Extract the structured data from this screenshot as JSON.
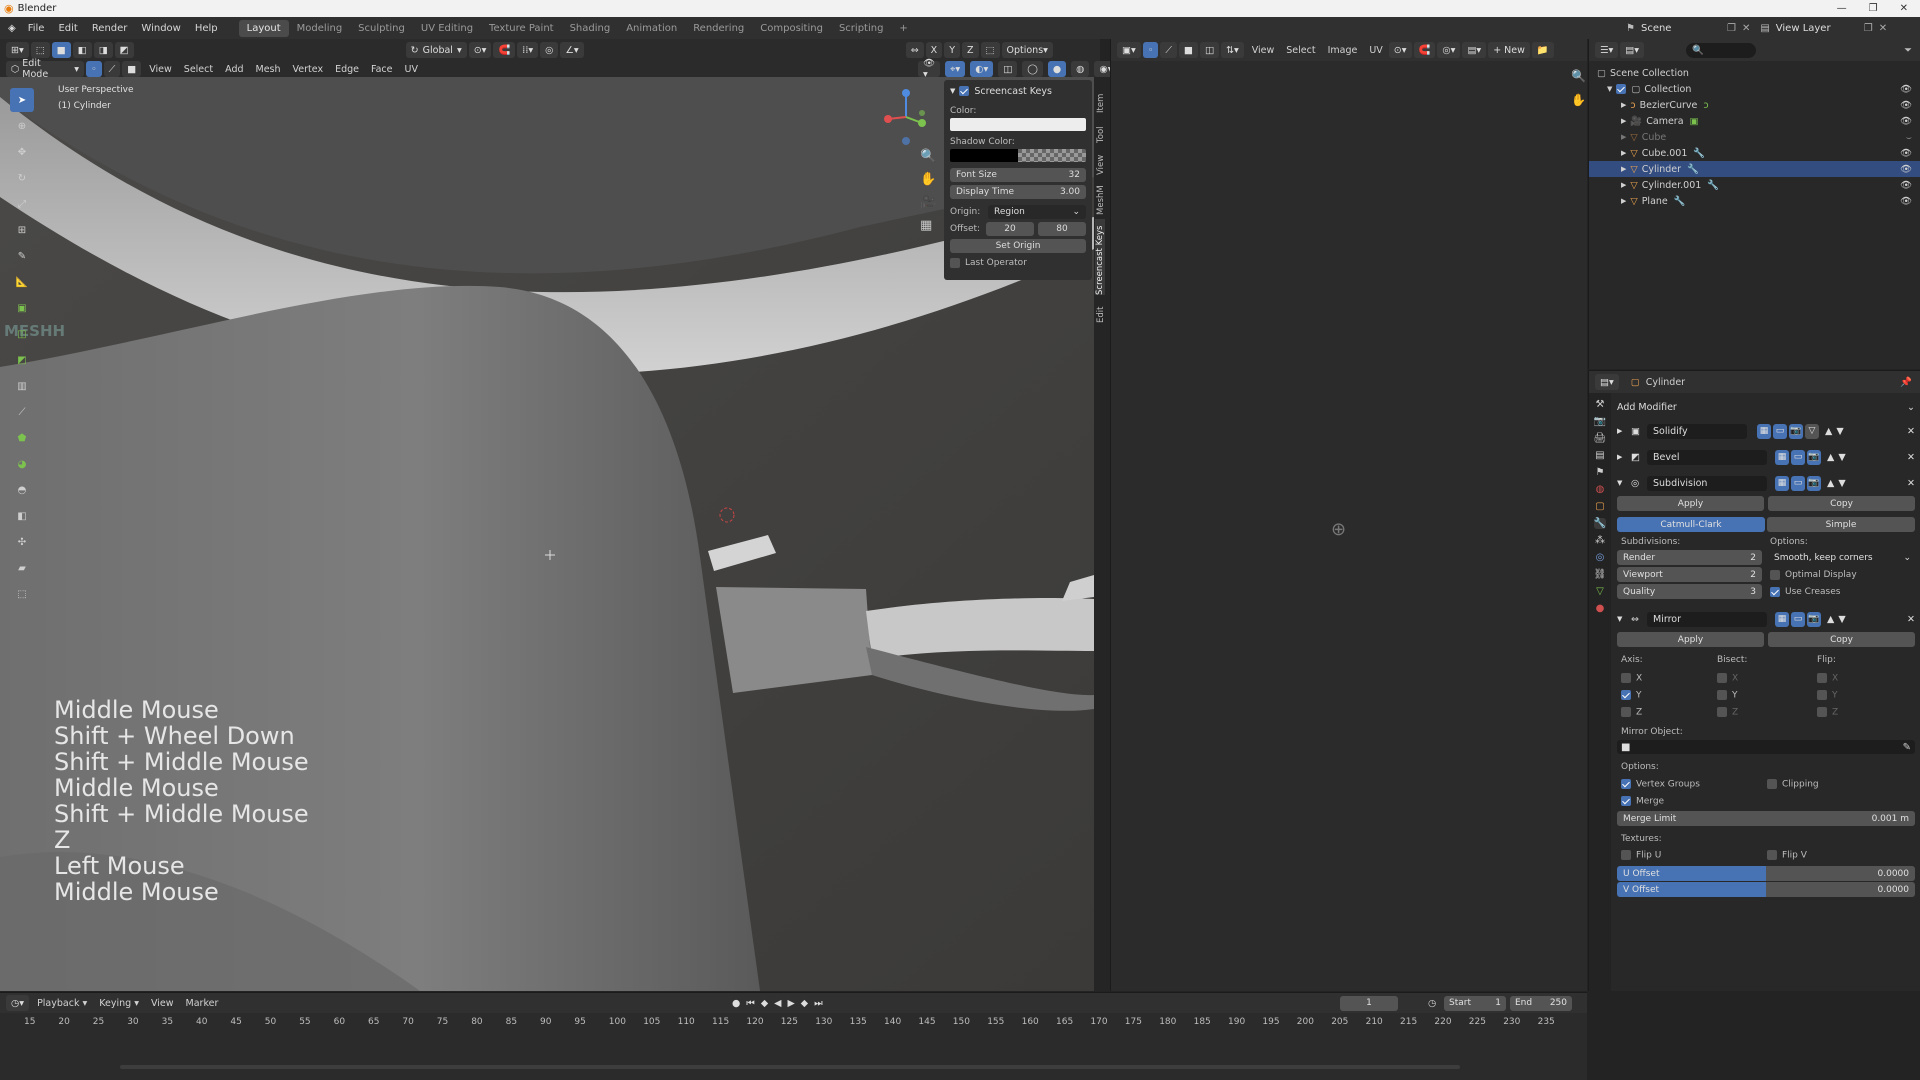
{
  "app": {
    "title": "Blender"
  },
  "menu": [
    "File",
    "Edit",
    "Render",
    "Window",
    "Help"
  ],
  "workspaces": [
    "Layout",
    "Modeling",
    "Sculpting",
    "UV Editing",
    "Texture Paint",
    "Shading",
    "Animation",
    "Rendering",
    "Compositing",
    "Scripting"
  ],
  "top_right": {
    "scene": "Scene",
    "view_layer": "View Layer"
  },
  "viewport_header": {
    "transform_orient": "Global",
    "axes": [
      "X",
      "Y",
      "Z"
    ],
    "options": "Options",
    "mode": "Edit Mode",
    "menus": [
      "View",
      "Select",
      "Add",
      "Mesh",
      "Vertex",
      "Edge",
      "Face",
      "UV"
    ]
  },
  "viewport": {
    "perspective": "User Perspective",
    "object": "(1) Cylinder",
    "watermark": "MESHH",
    "key_log": [
      "Middle Mouse",
      "Shift + Wheel Down",
      "Shift + Middle Mouse",
      "Middle Mouse",
      "Shift + Middle Mouse",
      "Z",
      "Left Mouse",
      "Middle Mouse"
    ]
  },
  "screencast": {
    "title": "Screencast Keys",
    "color_label": "Color:",
    "shadow_label": "Shadow Color:",
    "font_size_label": "Font Size",
    "font_size": "32",
    "display_time_label": "Display Time",
    "display_time": "3.00",
    "origin_label": "Origin:",
    "origin": "Region",
    "offset_label": "Offset:",
    "offset_x": "20",
    "offset_y": "80",
    "set_origin": "Set Origin",
    "last_operator": "Last Operator",
    "colors": {
      "text": "#ededed",
      "shadow": "#000000"
    }
  },
  "side_tabs": [
    "Item",
    "Tool",
    "View",
    "MeshM",
    "Screencast Keys",
    "Edit"
  ],
  "image_editor": {
    "menus": [
      "View",
      "Select",
      "Image",
      "UV"
    ],
    "new": "New"
  },
  "outliner": {
    "root": "Scene Collection",
    "collection": "Collection",
    "items": [
      "BezierCurve",
      "Camera",
      "Cube",
      "Cube.001",
      "Cylinder",
      "Cylinder.001",
      "Plane"
    ]
  },
  "properties": {
    "object": "Cylinder",
    "add_modifier": "Add Modifier",
    "modifiers": [
      "Solidify",
      "Bevel",
      "Subdivision",
      "Mirror"
    ],
    "apply": "Apply",
    "copy": "Copy",
    "subdiv": {
      "catmull": "Catmull-Clark",
      "simple": "Simple",
      "subdivisions": "Subdivisions:",
      "options": "Options:",
      "render_label": "Render",
      "render": "2",
      "viewport_label": "Viewport",
      "viewport": "2",
      "quality_label": "Quality",
      "quality": "3",
      "uv_smooth": "Smooth, keep corners",
      "optimal_display": "Optimal Display",
      "use_creases": "Use Creases"
    },
    "mirror": {
      "axis": "Axis:",
      "bisect": "Bisect:",
      "flip": "Flip:",
      "x": "X",
      "y": "Y",
      "z": "Z",
      "mirror_object": "Mirror Object:",
      "options": "Options:",
      "vertex_groups": "Vertex Groups",
      "clipping": "Clipping",
      "merge": "Merge",
      "merge_limit_label": "Merge Limit",
      "merge_limit": "0.001 m",
      "textures": "Textures:",
      "flip_u": "Flip U",
      "flip_v": "Flip V",
      "u_offset_label": "U Offset",
      "u_offset": "0.0000",
      "v_offset_label": "V Offset",
      "v_offset": "0.0000"
    }
  },
  "timeline": {
    "menus": [
      "Playback",
      "Keying",
      "View",
      "Marker"
    ],
    "current_frame": "1",
    "start_label": "Start",
    "start": "1",
    "end_label": "End",
    "end": "250",
    "ticks": [
      "15",
      "20",
      "25",
      "30",
      "35",
      "40",
      "45",
      "50",
      "55",
      "60",
      "65",
      "70",
      "75",
      "80",
      "85",
      "90",
      "95",
      "100",
      "105",
      "110",
      "115",
      "120",
      "125",
      "130",
      "135",
      "140",
      "145",
      "150",
      "155",
      "160",
      "165",
      "170",
      "175",
      "180",
      "185",
      "190",
      "195",
      "200",
      "205",
      "210",
      "215",
      "220",
      "225",
      "230",
      "235"
    ]
  },
  "colors": {
    "accent": "#4772b3",
    "bg": "#232323",
    "header": "#2b2b2b"
  }
}
